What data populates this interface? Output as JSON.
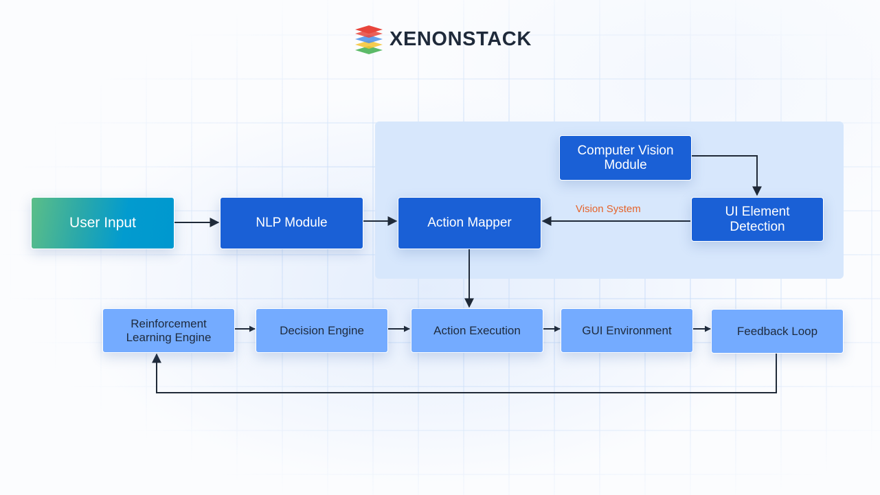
{
  "header": {
    "brand": "XENONSTACK",
    "logo_icon": "layered-stack-icon",
    "logo_layer_colors": [
      "#e8453c",
      "#4a8fea",
      "#f5c331",
      "#3fae4e"
    ]
  },
  "colors": {
    "panel_background": "#d7e7fc",
    "primary_node": "#1a60d6",
    "secondary_node": "#74abff",
    "input_gradient_start": "#5bbe88",
    "input_gradient_end": "#0098cf",
    "edge_color": "#1f2937",
    "edge_label_color": "#e5632a"
  },
  "diagram": {
    "group": {
      "name": "vision-system-group",
      "label": "Vision System"
    },
    "nodes": [
      {
        "id": "user_input",
        "label": "User Input",
        "style": "input"
      },
      {
        "id": "nlp_module",
        "label": "NLP Module",
        "style": "primary"
      },
      {
        "id": "action_mapper",
        "label": "Action Mapper",
        "style": "primary"
      },
      {
        "id": "computer_vision_module",
        "label": "Computer Vision Module",
        "style": "primary"
      },
      {
        "id": "ui_element_detection",
        "label": "UI Element Detection",
        "style": "primary"
      },
      {
        "id": "rl_engine",
        "label": "Reinforcement Learning Engine",
        "style": "secondary"
      },
      {
        "id": "decision_engine",
        "label": "Decision Engine",
        "style": "secondary"
      },
      {
        "id": "action_execution",
        "label": "Action Execution",
        "style": "secondary"
      },
      {
        "id": "gui_environment",
        "label": "GUI Environment",
        "style": "secondary"
      },
      {
        "id": "feedback_loop",
        "label": "Feedback Loop",
        "style": "secondary"
      }
    ],
    "edges": [
      {
        "from": "user_input",
        "to": "nlp_module",
        "label": ""
      },
      {
        "from": "nlp_module",
        "to": "action_mapper",
        "label": ""
      },
      {
        "from": "computer_vision_module",
        "to": "ui_element_detection",
        "label": ""
      },
      {
        "from": "ui_element_detection",
        "to": "action_mapper",
        "label": "Vision System"
      },
      {
        "from": "action_mapper",
        "to": "action_execution",
        "label": ""
      },
      {
        "from": "rl_engine",
        "to": "decision_engine",
        "label": ""
      },
      {
        "from": "decision_engine",
        "to": "action_execution",
        "label": ""
      },
      {
        "from": "action_execution",
        "to": "gui_environment",
        "label": ""
      },
      {
        "from": "gui_environment",
        "to": "feedback_loop",
        "label": ""
      },
      {
        "from": "feedback_loop",
        "to": "rl_engine",
        "label": ""
      }
    ]
  }
}
